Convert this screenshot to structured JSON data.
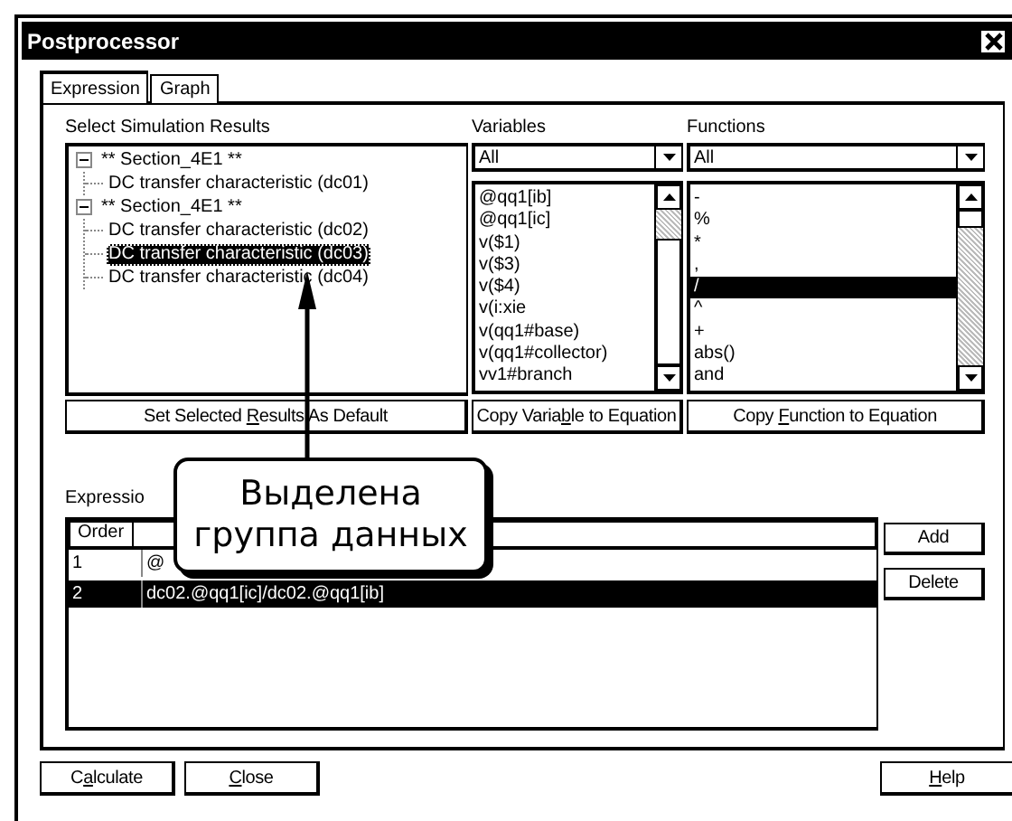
{
  "window": {
    "title": "Postprocessor"
  },
  "tabs": [
    {
      "label": "Expression",
      "selected": true
    },
    {
      "label": "Graph",
      "selected": false
    }
  ],
  "results": {
    "label": "Select Simulation Results",
    "tree": [
      {
        "label": "** Section_4E1 **",
        "expanded": true,
        "selected": false,
        "children": [
          {
            "label": "DC transfer characteristic (dc01)",
            "selected": false
          }
        ]
      },
      {
        "label": "** Section_4E1 **",
        "expanded": true,
        "selected": false,
        "children": [
          {
            "label": "DC transfer characteristic (dc02)",
            "selected": false
          },
          {
            "label": "DC transfer characteristic (dc03)",
            "selected": true
          },
          {
            "label": "DC transfer characteristic (dc04)",
            "selected": false
          }
        ]
      }
    ]
  },
  "variables": {
    "label": "Variables",
    "filter": "All",
    "items": [
      {
        "text": "@qq1[ib]",
        "selected": false
      },
      {
        "text": "@qq1[ic]",
        "selected": false
      },
      {
        "text": "v($1)",
        "selected": false
      },
      {
        "text": "v($3)",
        "selected": false
      },
      {
        "text": "v($4)",
        "selected": false
      },
      {
        "text": "v(i:xie",
        "selected": false
      },
      {
        "text": "v(qq1#base)",
        "selected": false
      },
      {
        "text": "v(qq1#collector)",
        "selected": false
      },
      {
        "text": "vv1#branch",
        "selected": false
      }
    ]
  },
  "functions": {
    "label": "Functions",
    "filter": "All",
    "items": [
      {
        "text": "-",
        "selected": false
      },
      {
        "text": "%",
        "selected": false
      },
      {
        "text": "*",
        "selected": false
      },
      {
        "text": ",",
        "selected": false
      },
      {
        "text": "/",
        "selected": true
      },
      {
        "text": "^",
        "selected": false
      },
      {
        "text": "+",
        "selected": false
      },
      {
        "text": "abs()",
        "selected": false
      },
      {
        "text": "and",
        "selected": false
      }
    ]
  },
  "action_buttons": [
    {
      "before": "Set Selected ",
      "key": "R",
      "after": "esults As Default"
    },
    {
      "before": "Copy Varia",
      "key": "b",
      "after": "le to Equation"
    },
    {
      "before": "Copy ",
      "key": "F",
      "after": "unction to Equation"
    }
  ],
  "expressions": {
    "label": "Expressio",
    "columns": [
      "Order"
    ],
    "rows": [
      {
        "order": "1",
        "expression": "@",
        "selected": false
      },
      {
        "order": "2",
        "expression": "dc02.@qq1[ic]/dc02.@qq1[ib]",
        "selected": true
      }
    ],
    "buttons": [
      "Add",
      "Delete"
    ]
  },
  "bottom_buttons": [
    {
      "before": "C",
      "key": "a",
      "after": "lculate"
    },
    {
      "key": "C",
      "after": "lose"
    },
    {
      "key": "H",
      "after": "elp"
    }
  ],
  "callout": {
    "text": "Выделена\nгруппа данных"
  }
}
